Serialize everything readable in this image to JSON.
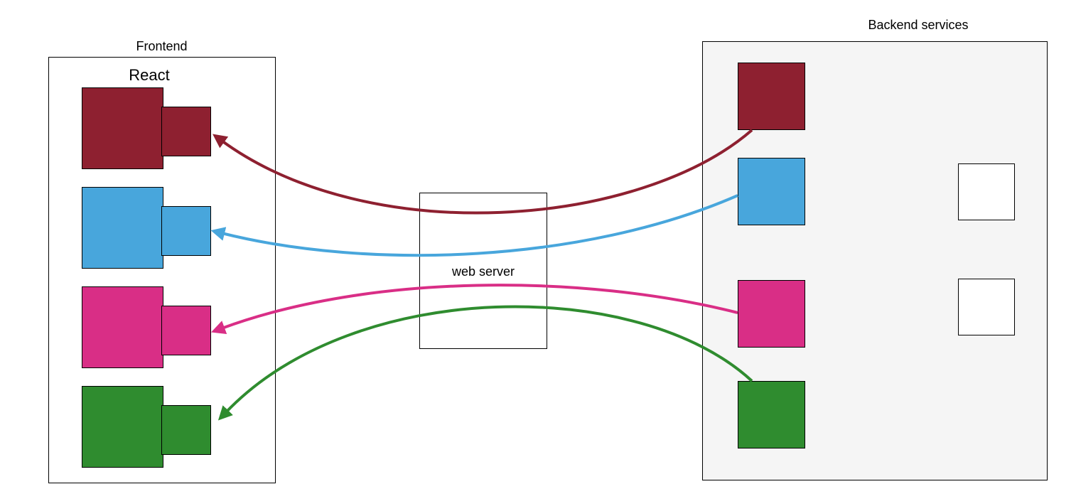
{
  "frontend": {
    "title": "Frontend",
    "subtitle": "React"
  },
  "center": {
    "label": "web server"
  },
  "backend": {
    "title": "Backend services"
  },
  "colors": {
    "maroon": "#8e2030",
    "blue": "#48a6dc",
    "pink": "#d92e86",
    "green": "#2f8c2f",
    "backendFill": "#f5f5f5"
  },
  "services": [
    "maroon",
    "blue",
    "pink",
    "green"
  ]
}
